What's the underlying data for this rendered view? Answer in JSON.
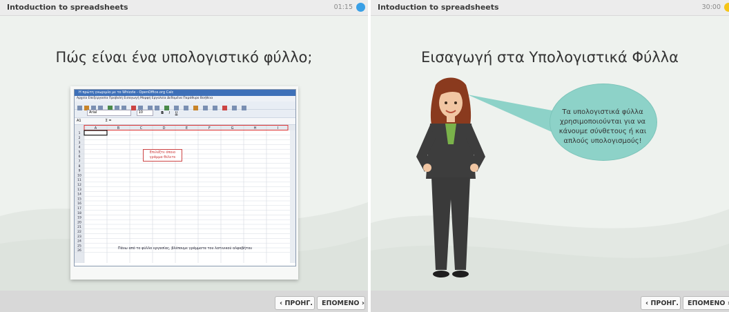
{
  "left": {
    "title": "Intoduction to spreadsheets",
    "timer": "01:15",
    "heading": "Πώς είναι ένα υπολογιστικό φύλλο;",
    "spreadsheet": {
      "window_title": "Η πρώτη γνωριμία με το Whizzle - OpenOffice.org Calc",
      "menu": "Αρχείο  Επεξεργασία  Προβολή  Εισαγωγή  Μορφή  Εργαλεία  Δεδομένα  Παράθυρο  Βοήθεια",
      "font_name": "Arial",
      "font_size": "10",
      "cell_ref": "A1",
      "columns": [
        "A",
        "B",
        "C",
        "D",
        "E",
        "F",
        "G",
        "H",
        "I"
      ],
      "rows": [
        "1",
        "2",
        "3",
        "4",
        "5",
        "6",
        "7",
        "8",
        "9",
        "10",
        "11",
        "12",
        "13",
        "14",
        "15",
        "16",
        "17",
        "18",
        "19",
        "20",
        "21",
        "22",
        "23",
        "24",
        "25",
        "26"
      ],
      "callout_lines": [
        "Επιλέξτε όποιο",
        "γράμμα θέλετε"
      ],
      "caption": "Πάνω από το φύλλο εργασίας, βλέπουμε γράμματα του λατινικού αλφαβήτου"
    },
    "prev_label": "ΠΡΟΗΓ.",
    "next_label": "ΕΠΟΜΕΝΟ",
    "timer_color": "#3aa0e6"
  },
  "right": {
    "title": "Intoduction to spreadsheets",
    "timer": "30:00",
    "heading": "Εισαγωγή στα Υπολογιστικά Φύλλα",
    "bubble_lines": [
      "Τα υπολογιστικά φύλλα",
      "χρησιμοποιούνται για να",
      "κάνουμε σύνθετους ή και",
      "απλούς υπολογισμούς!"
    ],
    "prev_label": "ΠΡΟΗΓ.",
    "next_label": "ΕΠΟΜΕΝΟ",
    "timer_color": "#f5c518"
  },
  "icons": {
    "prev": "chevron-left-icon",
    "next": "chevron-right-icon",
    "timer_indicator": "status-dot-icon"
  }
}
